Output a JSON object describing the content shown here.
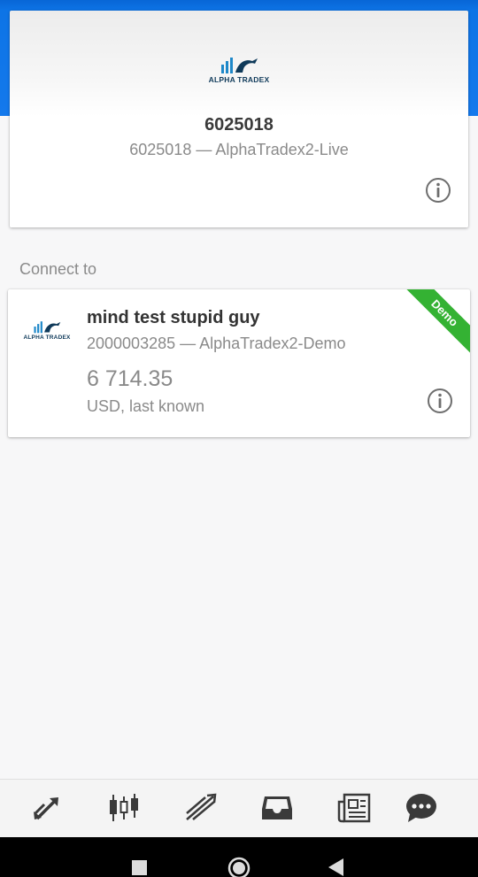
{
  "account": {
    "logo_text": "ALPHA TRADEX",
    "number": "6025018",
    "server_line": "6025018 — AlphaTradex2-Live"
  },
  "connect_label": "Connect to",
  "demo_account": {
    "logo_text": "ALPHA TRADEX",
    "name": "mind test stupid guy",
    "server_line": "2000003285 — AlphaTradex2-Demo",
    "balance": "6 714.35",
    "currency_line": "USD, last known",
    "badge": "Demo"
  },
  "bottom_nav": {
    "items": [
      "quotes-icon",
      "chart-icon",
      "trade-icon",
      "mailbox-icon",
      "news-icon",
      "chat-icon"
    ]
  },
  "system_nav": {
    "items": [
      "recents-icon",
      "home-icon",
      "back-icon"
    ]
  },
  "colors": {
    "header_blue": "#1479ec",
    "demo_green": "#34b233",
    "nav_icon": "#3a3a3a"
  }
}
